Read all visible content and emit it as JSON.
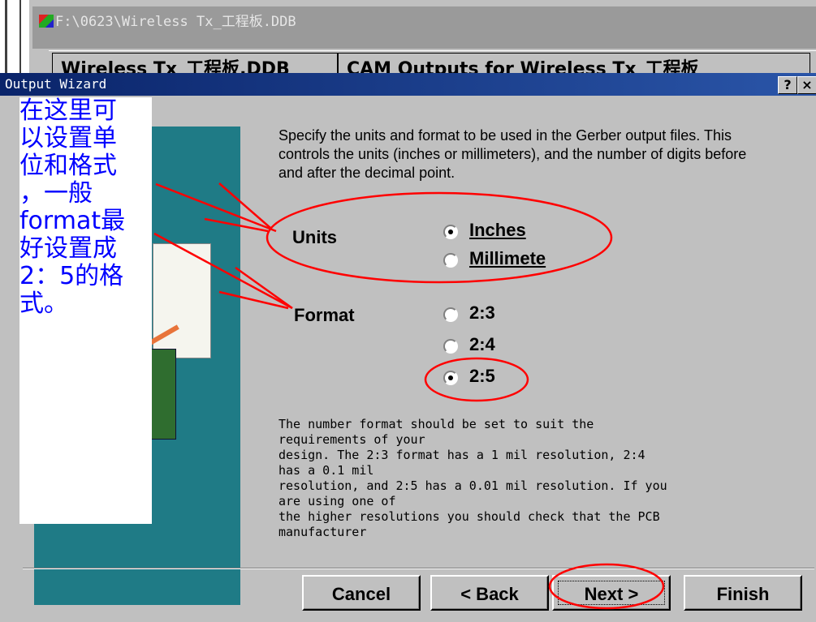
{
  "background_window": {
    "title": "F:\\0623\\Wireless Tx_工程板.DDB",
    "tabs": [
      "Wireless Tx_工程板.DDB",
      "CAM Outputs for Wireless Tx_工程板"
    ]
  },
  "dialog": {
    "title": "Output Wizard",
    "help_label": "?",
    "close_label": "×",
    "description": "Specify the units and format to be used in the Gerber output files. This controls the units (inches or millimeters), and the number of digits before and after the decimal point.",
    "units": {
      "label": "Units",
      "options": [
        {
          "label": "Inches",
          "selected": true
        },
        {
          "label": "Millimete",
          "selected": false
        }
      ]
    },
    "format": {
      "label": "Format",
      "options": [
        {
          "label": "2:3",
          "selected": false
        },
        {
          "label": "2:4",
          "selected": false
        },
        {
          "label": "2:5",
          "selected": true
        }
      ]
    },
    "info_lines": [
      "The number format should be set to suit the",
      "requirements of your",
      "design. The 2:3 format has a 1 mil resolution, 2:4",
      "has a 0.1 mil",
      "resolution, and 2:5 has a 0.01 mil resolution. If you",
      "are using one of",
      "the higher resolutions you should check that the PCB",
      "manufacturer"
    ],
    "buttons": {
      "cancel": "Cancel",
      "back": "< Back",
      "next": "Next >",
      "finish": "Finish"
    }
  },
  "annotation": {
    "note_lines": [
      "在这里可",
      "以设置单",
      "位和格式",
      "，一般",
      "format最",
      "好设置成",
      "2：5的格",
      "式。"
    ],
    "color": "#0000ff",
    "marker_color": "#ff0000"
  },
  "colors": {
    "titlebar": "#0a246a",
    "dialog_bg": "#c0c0c0",
    "wizard_art": "#1f7b86"
  }
}
